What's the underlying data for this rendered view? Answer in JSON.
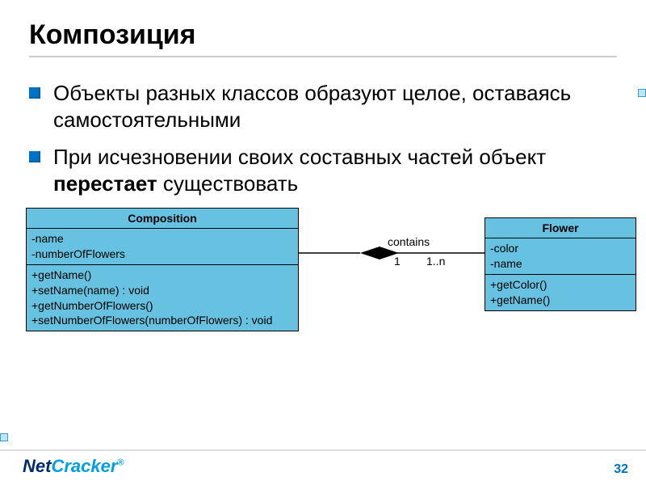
{
  "title": "Композиция",
  "bullets": [
    {
      "text": "Объекты разных классов образуют целое, оставаясь самостоятельными"
    },
    {
      "text_html": "При исчезновении своих составных частей объект <b>перестает</b> существовать"
    }
  ],
  "uml": {
    "composition": {
      "name": "Composition",
      "attributes": [
        "-name",
        "-numberOfFlowers"
      ],
      "methods": [
        "+getName()",
        "+setName(name) : void",
        "+getNumberOfFlowers()",
        "+setNumberOfFlowers(numberOfFlowers) : void"
      ]
    },
    "flower": {
      "name": "Flower",
      "attributes": [
        "-color",
        "-name"
      ],
      "methods": [
        "+getColor()",
        "+getName()"
      ]
    },
    "relation": {
      "label": "contains",
      "left_mult": "1",
      "right_mult": "1..n"
    }
  },
  "footer": {
    "logo_net": "Net",
    "logo_cracker": "Cracker",
    "reg": "®",
    "page": "32"
  }
}
